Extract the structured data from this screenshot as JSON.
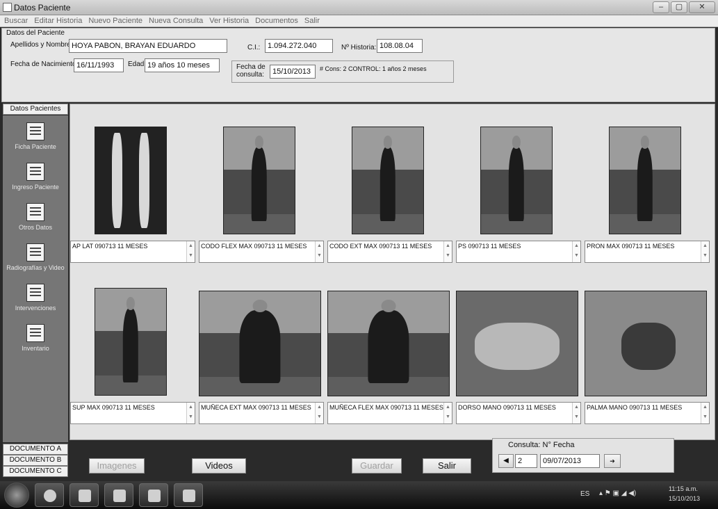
{
  "window": {
    "title": "Datos Paciente",
    "min": "–",
    "max": "▢",
    "close": "✕"
  },
  "menu": [
    "Buscar",
    "Editar Historia",
    "Nuevo Paciente",
    "Nueva Consulta",
    "Ver Historia",
    "Documentos",
    "Salir"
  ],
  "patient": {
    "legend": "Datos del Paciente",
    "name_label": "Apellidos y Nombres:",
    "name": "HOYA PABON, BRAYAN EDUARDO",
    "ci_label": "C.I.:",
    "ci": "1.094.272.040",
    "historia_label": "Nº Historia:",
    "historia": "108.08.04",
    "birth_label": "Fecha de Nacimiento:",
    "birth": "16/11/1993",
    "age_label": "Edad:",
    "age": "19 años 10 meses",
    "consult_date_label": "Fecha de consulta:",
    "consult_date": "15/10/2013",
    "consult_info": "# Cons: 2  CONTROL: 1 años 2 meses"
  },
  "sidebar": {
    "header": "Datos Pacientes",
    "items": [
      {
        "label": "Ficha Paciente",
        "icon": "patient-file-icon"
      },
      {
        "label": "Ingreso Paciente",
        "icon": "patient-admission-icon"
      },
      {
        "label": "Otros Datos",
        "icon": "other-data-icon"
      },
      {
        "label": "Radiografías y Video",
        "icon": "xray-video-icon"
      },
      {
        "label": "Intervenciones",
        "icon": "interventions-icon"
      },
      {
        "label": "Inventario",
        "icon": "inventory-icon"
      }
    ],
    "documents": [
      "DOCUMENTO A",
      "DOCUMENTO B",
      "DOCUMENTO C"
    ]
  },
  "gallery": [
    {
      "caption": "AP LAT 090713 11 MESES",
      "kind": "xray"
    },
    {
      "caption": "CODO FLEX MAX 090713 11 MESES",
      "kind": "person"
    },
    {
      "caption": "CODO EXT MAX 090713 11 MESES",
      "kind": "person"
    },
    {
      "caption": "PS 090713 11 MESES",
      "kind": "person"
    },
    {
      "caption": "PRON MAX 090713 11 MESES",
      "kind": "person"
    },
    {
      "caption": "SUP MAX 090713 11 MESES",
      "kind": "person"
    },
    {
      "caption": "MUÑECA EXT MAX 090713 11 MESES",
      "kind": "person"
    },
    {
      "caption": "MUÑECA FLEX MAX 090713 11 MESES",
      "kind": "person"
    },
    {
      "caption": "DORSO MANO 090713 11 MESES",
      "kind": "hand"
    },
    {
      "caption": "PALMA MANO 090713 11 MESES",
      "kind": "hand"
    }
  ],
  "buttons": {
    "imagenes": "Imagenes",
    "videos": "Videos",
    "guardar": "Guardar",
    "salir": "Salir"
  },
  "consulta": {
    "label": "Consulta: N° Fecha",
    "number": "2",
    "date": "09/07/2013"
  },
  "taskbar": {
    "lang": "ES",
    "time": "11:15 a.m.",
    "date": "15/10/2013"
  }
}
